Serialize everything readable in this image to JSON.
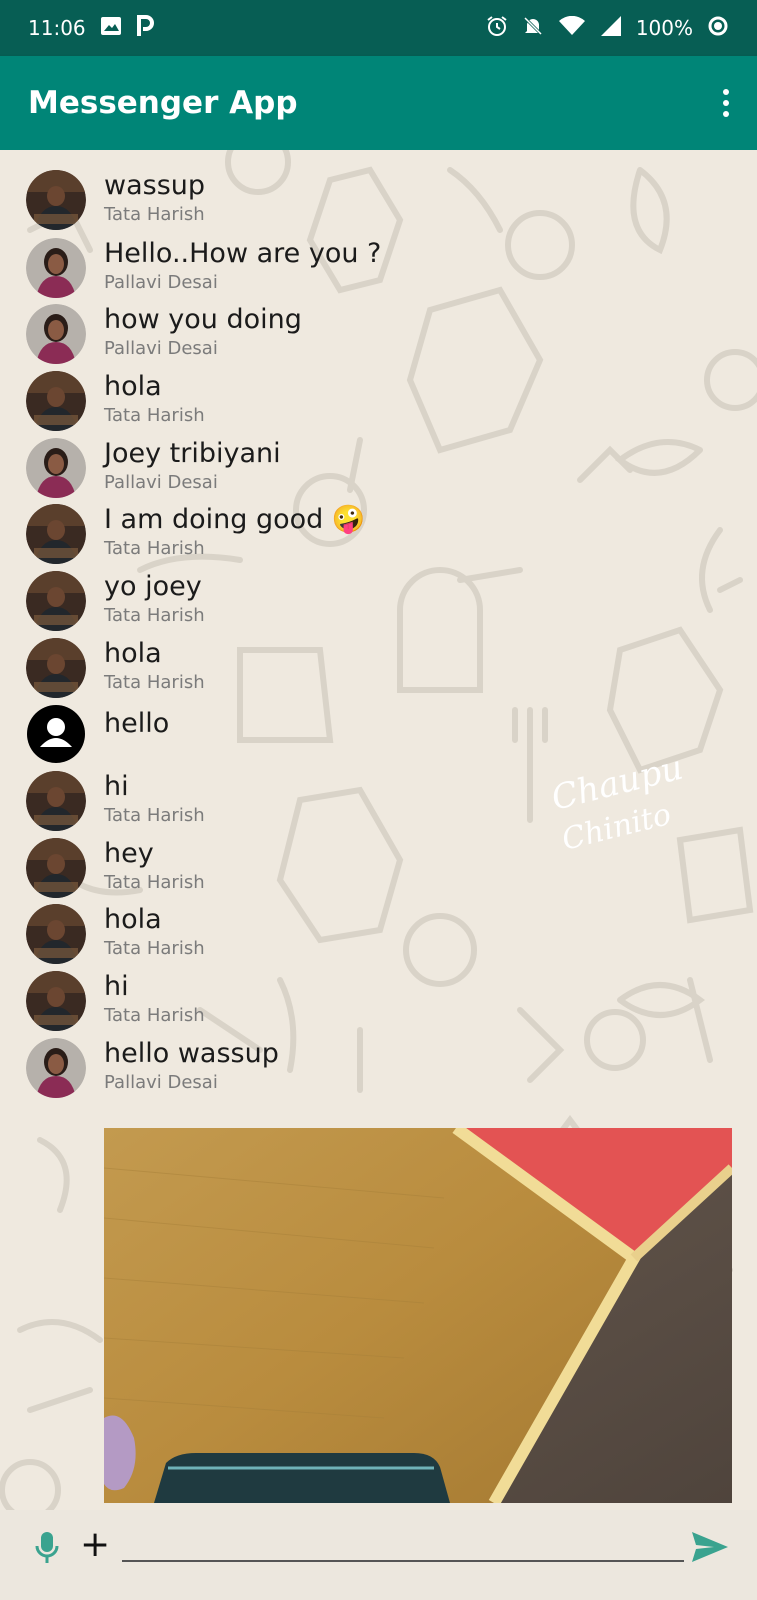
{
  "status_bar": {
    "time": "11:06",
    "battery": "100%",
    "left_icons": [
      "image-icon",
      "parking-icon"
    ],
    "right_icons": [
      "alarm-icon",
      "notifications-off-icon",
      "wifi-icon",
      "signal-icon",
      "battery-ring-icon"
    ]
  },
  "app_bar": {
    "title": "Messenger App",
    "menu_icon": "more-vert-icon",
    "color": "#008577",
    "status_color": "#075e54"
  },
  "messages": [
    {
      "text": "wassup",
      "sender": "Tata Harish",
      "avatar": "tata"
    },
    {
      "text": "Hello..How are you ?",
      "sender": "Pallavi Desai",
      "avatar": "pallavi"
    },
    {
      "text": "how you doing",
      "sender": "Pallavi Desai",
      "avatar": "pallavi"
    },
    {
      "text": "hola",
      "sender": "Tata Harish",
      "avatar": "tata"
    },
    {
      "text": "Joey tribiyani",
      "sender": "Pallavi Desai",
      "avatar": "pallavi"
    },
    {
      "text": "I am doing good 🤪",
      "sender": "Tata Harish",
      "avatar": "tata"
    },
    {
      "text": "yo joey",
      "sender": "Tata Harish",
      "avatar": "tata"
    },
    {
      "text": "hola",
      "sender": "Tata Harish",
      "avatar": "tata"
    },
    {
      "text": "hello",
      "sender": "",
      "avatar": "default"
    },
    {
      "text": "hi",
      "sender": "Tata Harish",
      "avatar": "tata"
    },
    {
      "text": "hey",
      "sender": "Tata Harish",
      "avatar": "tata"
    },
    {
      "text": "hola",
      "sender": "Tata Harish",
      "avatar": "tata"
    },
    {
      "text": "hi",
      "sender": "Tata Harish",
      "avatar": "tata"
    },
    {
      "text": "hello wassup",
      "sender": "Pallavi Desai",
      "avatar": "pallavi"
    }
  ],
  "input": {
    "placeholder": "",
    "mic_icon": "mic-icon",
    "plus_icon": "plus-icon",
    "send_icon": "send-icon",
    "accent": "#3aa38f"
  }
}
